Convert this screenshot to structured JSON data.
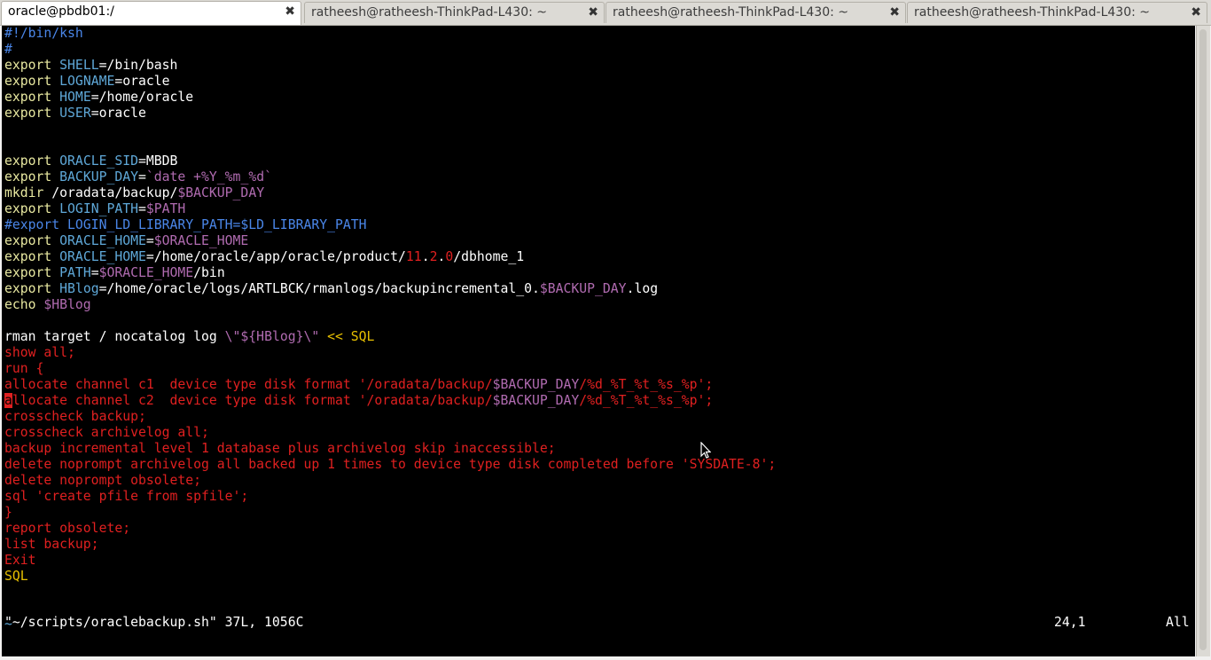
{
  "tabs": [
    {
      "label": "oracle@pbdb01:/",
      "active": true
    },
    {
      "label": "ratheesh@ratheesh-ThinkPad-L430: ~",
      "active": false
    },
    {
      "label": "ratheesh@ratheesh-ThinkPad-L430: ~",
      "active": false
    },
    {
      "label": "ratheesh@ratheesh-ThinkPad-L430: ~",
      "active": false
    }
  ],
  "close_glyph": "✖",
  "editor": {
    "lines": [
      [
        [
          "#!/bin/ksh",
          "cm"
        ]
      ],
      [
        [
          "#",
          "cm"
        ]
      ],
      [
        [
          "export ",
          "kw"
        ],
        [
          "SHELL",
          "var"
        ],
        [
          "=/bin/bash",
          ""
        ]
      ],
      [
        [
          "export ",
          "kw"
        ],
        [
          "LOGNAME",
          "var"
        ],
        [
          "=oracle",
          ""
        ]
      ],
      [
        [
          "export ",
          "kw"
        ],
        [
          "HOME",
          "var"
        ],
        [
          "=/home/oracle",
          ""
        ]
      ],
      [
        [
          "export ",
          "kw"
        ],
        [
          "USER",
          "var"
        ],
        [
          "=oracle",
          ""
        ]
      ],
      [],
      [],
      [
        [
          "export ",
          "kw"
        ],
        [
          "ORACLE_SID",
          "var"
        ],
        [
          "=MBDB",
          ""
        ]
      ],
      [
        [
          "export ",
          "kw"
        ],
        [
          "BACKUP_DAY",
          "var"
        ],
        [
          "=",
          ""
        ],
        [
          "`date +%Y_%m_%d`",
          "str"
        ]
      ],
      [
        [
          "mkdir ",
          "kw"
        ],
        [
          "/oradata/backup/",
          ""
        ],
        [
          "$BACKUP_DAY",
          "str"
        ]
      ],
      [
        [
          "export ",
          "kw"
        ],
        [
          "LOGIN_PATH",
          "var"
        ],
        [
          "=",
          ""
        ],
        [
          "$PATH",
          "str"
        ]
      ],
      [
        [
          "#export LOGIN_LD_LIBRARY_PATH=$LD_LIBRARY_PATH",
          "cm"
        ]
      ],
      [
        [
          "export ",
          "kw"
        ],
        [
          "ORACLE_HOME",
          "var"
        ],
        [
          "=",
          ""
        ],
        [
          "$ORACLE_HOME",
          "str"
        ]
      ],
      [
        [
          "export ",
          "kw"
        ],
        [
          "ORACLE_HOME",
          "var"
        ],
        [
          "=/home/oracle/app/oracle/product/",
          ""
        ],
        [
          "11",
          "num"
        ],
        [
          ".",
          ""
        ],
        [
          "2",
          "num"
        ],
        [
          ".",
          ""
        ],
        [
          "0",
          "num"
        ],
        [
          "/dbhome_1",
          ""
        ]
      ],
      [
        [
          "export ",
          "kw"
        ],
        [
          "PATH",
          "var"
        ],
        [
          "=",
          ""
        ],
        [
          "$ORACLE_HOME",
          "str"
        ],
        [
          "/bin",
          ""
        ]
      ],
      [
        [
          "export ",
          "kw"
        ],
        [
          "HBlog",
          "var"
        ],
        [
          "=/home/oracle/logs/ARTLBCK/rmanlogs/backupincremental_0.",
          ""
        ],
        [
          "$BACKUP_DAY",
          "str"
        ],
        [
          ".log",
          ""
        ]
      ],
      [
        [
          "echo ",
          "kw"
        ],
        [
          "$HBlog",
          "str"
        ]
      ],
      [],
      [
        [
          "rman target / nocatalog log ",
          ""
        ],
        [
          "\\\"",
          "str"
        ],
        [
          "${HBlog}",
          "str"
        ],
        [
          "\\\"",
          "str"
        ],
        [
          " << SQL",
          "yel"
        ]
      ],
      [
        [
          "show all;",
          "red"
        ]
      ],
      [
        [
          "run {",
          "red"
        ]
      ],
      [
        [
          "allocate channel c1  device type disk format '/oradata/backup/",
          "red"
        ],
        [
          "$BACKUP_DAY",
          "str"
        ],
        [
          "/%d_%T_%t_%s_%p';",
          "red"
        ]
      ],
      [
        [
          "a",
          "cursor"
        ],
        [
          "llocate channel c2  device type disk format '/oradata/backup/",
          "red"
        ],
        [
          "$BACKUP_DAY",
          "str"
        ],
        [
          "/%d_%T_%t_%s_%p';",
          "red"
        ]
      ],
      [
        [
          "crosscheck backup;",
          "red"
        ]
      ],
      [
        [
          "crosscheck archivelog all;",
          "red"
        ]
      ],
      [
        [
          "backup incremental level 1 database plus archivelog skip inaccessible;",
          "red"
        ]
      ],
      [
        [
          "delete noprompt archivelog all backed up 1 times to device type disk completed before 'SYSDATE-8';",
          "red"
        ]
      ],
      [
        [
          "delete noprompt obsolete;",
          "red"
        ]
      ],
      [
        [
          "sql 'create pfile from spfile';",
          "red"
        ]
      ],
      [
        [
          "}",
          "red"
        ]
      ],
      [
        [
          "report obsolete;",
          "red"
        ]
      ],
      [
        [
          "list backup;",
          "red"
        ]
      ],
      [
        [
          "Exit",
          "red"
        ]
      ],
      [
        [
          "SQL",
          "yel"
        ]
      ],
      [],
      [],
      [
        [
          "~",
          "var"
        ]
      ]
    ],
    "status_file": "\"~/scripts/oraclebackup.sh\" 37L, 1056C",
    "cursor_pos": "24,1",
    "scroll_pos": "All"
  },
  "colors": {
    "background": "#000000",
    "keyword": "#e8e8a0",
    "variable": "#5fa8d8",
    "string": "#b06bb0",
    "comment": "#4a86e8",
    "heredoc": "#e02020",
    "heredoc_delim": "#e8c000"
  },
  "icons": {
    "mouse_cursor": "arrow-pointer-icon",
    "tab_close": "close-icon"
  }
}
